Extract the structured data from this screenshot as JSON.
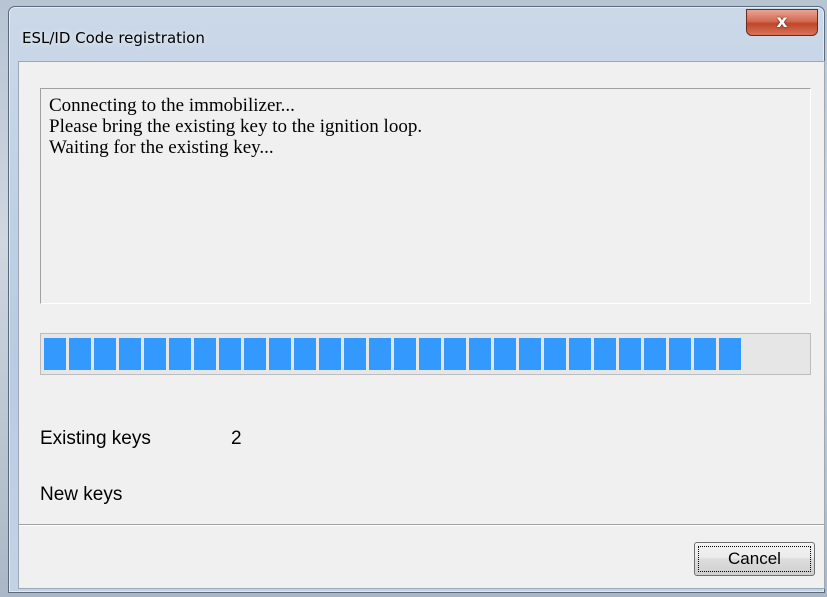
{
  "window": {
    "title": "ESL/ID Code registration",
    "close_glyph": "x"
  },
  "messages": [
    "Connecting to the immobilizer...",
    "Please bring the existing key to the ignition loop.",
    "Waiting for the existing key..."
  ],
  "progress": {
    "fraction": 0.91,
    "color": "#3399ff"
  },
  "fields": {
    "existing_keys_label": "Existing keys",
    "existing_keys_value": "2",
    "new_keys_label": "New keys",
    "new_keys_value": ""
  },
  "buttons": {
    "cancel_label": "Cancel"
  }
}
